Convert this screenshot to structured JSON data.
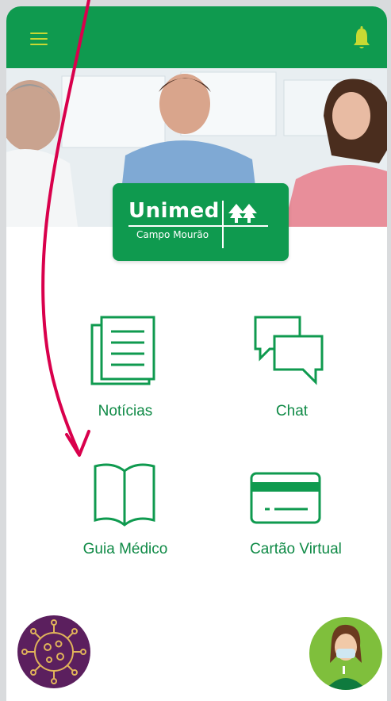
{
  "app": {
    "brand": "Unimed",
    "brand_sub": "Campo Mourão"
  },
  "colors": {
    "primary": "#0f9a4f",
    "accent": "#c8d933",
    "text_green": "#0f8a46",
    "arrow": "#d9004c",
    "virus_bg": "#5b1f5e"
  },
  "header": {
    "menu_icon": "hamburger-icon",
    "bell_icon": "bell-icon"
  },
  "menu": {
    "noticias": "Notícias",
    "chat": "Chat",
    "guia": "Guia Médico",
    "cartao": "Cartão Virtual"
  }
}
